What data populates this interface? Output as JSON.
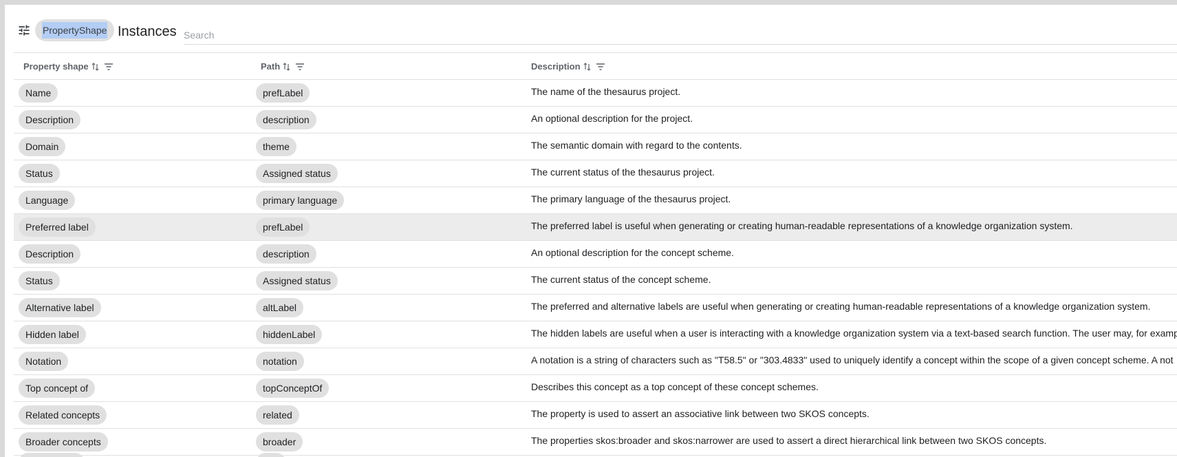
{
  "toolbar": {
    "type_chip": "PropertyShape",
    "title": "Instances",
    "search_placeholder": "Search",
    "search_value": ""
  },
  "columns": [
    "Property shape",
    "Path",
    "Description"
  ],
  "rows": [
    {
      "shape": "Name",
      "path": "prefLabel",
      "description": "The name of the thesaurus project."
    },
    {
      "shape": "Description",
      "path": "description",
      "description": "An optional description for the project."
    },
    {
      "shape": "Domain",
      "path": "theme",
      "description": "The semantic domain with regard to the contents."
    },
    {
      "shape": "Status",
      "path": "Assigned status",
      "description": "The current status of the thesaurus project."
    },
    {
      "shape": "Language",
      "path": "primary language",
      "description": "The primary language of the thesaurus project."
    },
    {
      "shape": "Preferred label",
      "path": "prefLabel",
      "description": "The preferred label is useful when generating or creating human-readable representations of a knowledge organization system.",
      "selected": true
    },
    {
      "shape": "Description",
      "path": "description",
      "description": "An optional description for the concept scheme."
    },
    {
      "shape": "Status",
      "path": "Assigned status",
      "description": "The current status of the concept scheme."
    },
    {
      "shape": "Alternative label",
      "path": "altLabel",
      "description": "The preferred and alternative labels are useful when generating or creating human-readable representations of a knowledge organization system."
    },
    {
      "shape": "Hidden label",
      "path": "hiddenLabel",
      "description": "The hidden labels are useful when a user is interacting with a knowledge organization system via a text-based search function. The user may, for examp"
    },
    {
      "shape": "Notation",
      "path": "notation",
      "description": "A notation is a string of characters such as \"T58.5\" or \"303.4833\" used to uniquely identify a concept within the scope of a given concept scheme. A not"
    },
    {
      "shape": "Top concept of",
      "path": "topConceptOf",
      "description": "Describes this concept as a top concept of these concept schemes."
    },
    {
      "shape": "Related concepts",
      "path": "related",
      "description": "The property is used to assert an associative link between two SKOS concepts."
    },
    {
      "shape": "Broader concepts",
      "path": "broader",
      "description": "The properties skos:broader and skos:narrower are used to assert a direct hierarchical link between two SKOS concepts."
    }
  ],
  "icons": {
    "tune": "tune-icon",
    "sort": "sort-icon",
    "filter": "filter-icon"
  },
  "colors": {
    "chip_bg": "#e0e0e0",
    "selection_highlight": "#b3cdf5",
    "selected_row": "#ececec"
  }
}
